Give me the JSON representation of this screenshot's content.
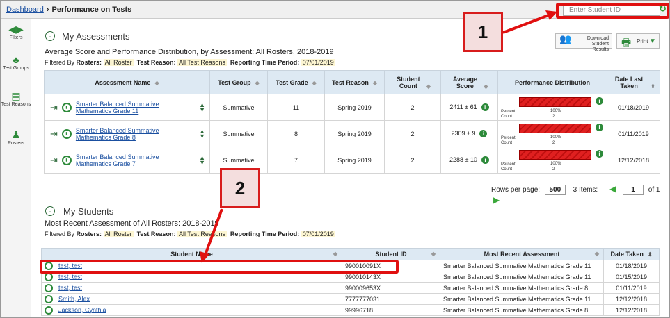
{
  "breadcrumb": {
    "home": "Dashboard",
    "current": "Performance on Tests"
  },
  "student_search": {
    "placeholder": "Enter Student ID"
  },
  "sidebar": [
    {
      "label": "Filters",
      "icon": "filter-arrows-icon"
    },
    {
      "label": "Test Groups",
      "icon": "test-groups-icon"
    },
    {
      "label": "Test Reasons",
      "icon": "test-reasons-icon"
    },
    {
      "label": "Rosters",
      "icon": "rosters-icon"
    }
  ],
  "assessments": {
    "title": "My Assessments",
    "subtitle": "Average Score and Performance Distribution, by Assessment: All Rosters, 2018-2019",
    "filters": {
      "prefix": "Filtered By",
      "rosters_label": "Rosters:",
      "rosters": "All Roster",
      "reason_label": "Test Reason:",
      "reason": "All Test Reasons",
      "period_label": "Reporting Time Period:",
      "period": "07/01/2019"
    },
    "download_label": "Download Student Results",
    "print_label": "Print",
    "columns": [
      "Assessment Name",
      "Test Group",
      "Test Grade",
      "Test Reason",
      "Student Count",
      "Average Score",
      "Performance Distribution",
      "Date Last Taken"
    ],
    "rows": [
      {
        "name": "Smarter Balanced Summative Mathematics Grade 11",
        "group": "Summative",
        "grade": "11",
        "reason": "Spring 2019",
        "count": "2",
        "avg": "2411 ± 61",
        "percent": "100%",
        "pcount": "2",
        "date": "01/18/2019"
      },
      {
        "name": "Smarter Balanced Summative Mathematics Grade 8",
        "group": "Summative",
        "grade": "8",
        "reason": "Spring 2019",
        "count": "2",
        "avg": "2309 ± 9",
        "percent": "100%",
        "pcount": "2",
        "date": "01/11/2019"
      },
      {
        "name": "Smarter Balanced Summative Mathematics Grade 7",
        "group": "Summative",
        "grade": "7",
        "reason": "Spring 2019",
        "count": "2",
        "avg": "2288 ± 10",
        "percent": "100%",
        "pcount": "2",
        "date": "12/12/2018"
      }
    ],
    "perf_labels": {
      "percent": "Percent",
      "count": "Count"
    },
    "pager": {
      "rows_label": "Rows per page:",
      "rows_value": "500",
      "items": "3 Items:",
      "page": "1",
      "of": "of 1"
    }
  },
  "students": {
    "title": "My Students",
    "subtitle": "Most Recent Assessment of All Rosters: 2018-2019",
    "filters": {
      "prefix": "Filtered By",
      "rosters_label": "Rosters:",
      "rosters": "All Roster",
      "reason_label": "Test Reason:",
      "reason": "All Test Reasons",
      "period_label": "Reporting Time Period:",
      "period": "07/01/2019"
    },
    "columns": [
      "Student Name",
      "Student ID",
      "Most Recent Assessment",
      "Date Taken"
    ],
    "rows": [
      {
        "name": "test, test",
        "id": "990010091X",
        "assessment": "Smarter Balanced Summative Mathematics Grade 11",
        "date": "01/18/2019"
      },
      {
        "name": "test, test",
        "id": "990010143X",
        "assessment": "Smarter Balanced Summative Mathematics Grade 11",
        "date": "01/15/2019"
      },
      {
        "name": "test, test",
        "id": "990009653X",
        "assessment": "Smarter Balanced Summative Mathematics Grade 8",
        "date": "01/11/2019"
      },
      {
        "name": "Smith, Alex",
        "id": "7777777031",
        "assessment": "Smarter Balanced Summative Mathematics Grade 11",
        "date": "12/12/2018"
      },
      {
        "name": "Jackson, Cynthia",
        "id": "99996718",
        "assessment": "Smarter Balanced Summative Mathematics Grade 8",
        "date": "12/12/2018"
      }
    ]
  },
  "callouts": [
    "1",
    "2"
  ],
  "colors": {
    "callout_red": "#e01010",
    "accent_green": "#2d8a3a",
    "header_blue": "#dde9f3",
    "link_blue": "#1a4fa0"
  }
}
